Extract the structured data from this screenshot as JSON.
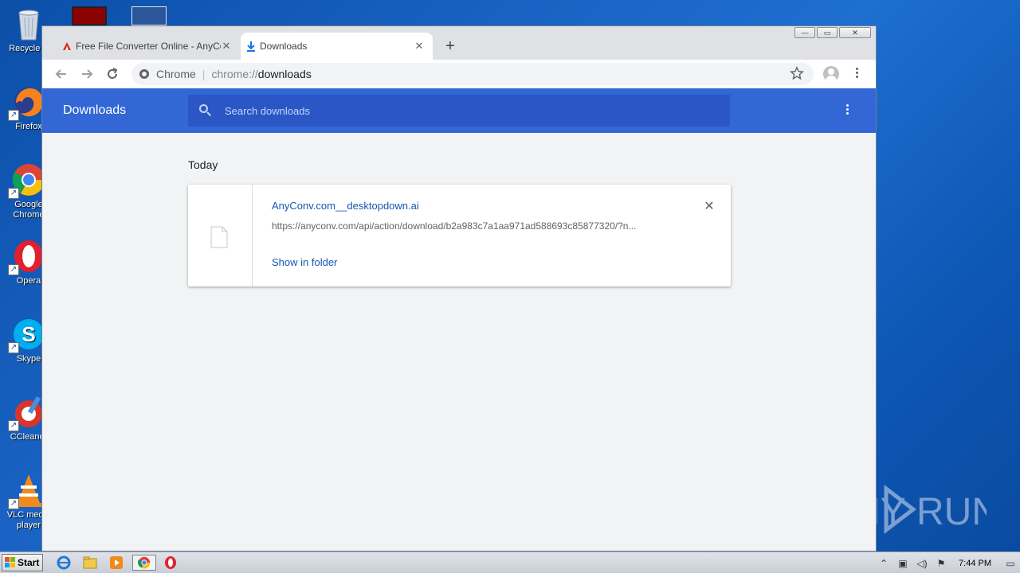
{
  "desktop": {
    "icons": [
      {
        "label": "Recycle B",
        "icon": "recycle-bin-icon"
      },
      {
        "label": "Firefox",
        "icon": "firefox-icon"
      },
      {
        "label": "Google Chrome",
        "icon": "chrome-icon"
      },
      {
        "label": "Opera",
        "icon": "opera-icon"
      },
      {
        "label": "Skype",
        "icon": "skype-icon"
      },
      {
        "label": "CCleaner",
        "icon": "ccleaner-icon"
      },
      {
        "label": "VLC media player",
        "icon": "vlc-icon"
      }
    ]
  },
  "browser": {
    "tabs": [
      {
        "title": "Free File Converter Online - AnyConv",
        "close": "✕",
        "icon": "anyconv-favicon"
      },
      {
        "title": "Downloads",
        "close": "✕",
        "icon": "download-icon"
      }
    ],
    "new_tab": "+",
    "window_controls": {
      "minimize": "—",
      "maximize": "▭",
      "close": "✕"
    },
    "toolbar": {
      "scheme_label": "Chrome",
      "url_proto": "chrome://",
      "url_host": "downloads"
    }
  },
  "downloads": {
    "title": "Downloads",
    "search_placeholder": "Search downloads",
    "section_date": "Today",
    "items": [
      {
        "file_name": "AnyConv.com__desktopdown.ai",
        "url": "https://anyconv.com/api/action/download/b2a983c7a1aa971ad588693c85877320/?n...",
        "action": "Show in folder",
        "remove": "✕"
      }
    ]
  },
  "taskbar": {
    "start_label": "Start",
    "clock": "7:44 PM"
  },
  "watermark": "ANY RUN",
  "colors": {
    "header_blue": "#3367d6",
    "link_blue": "#1558b0",
    "desktop_blue": "#1a63c4"
  }
}
